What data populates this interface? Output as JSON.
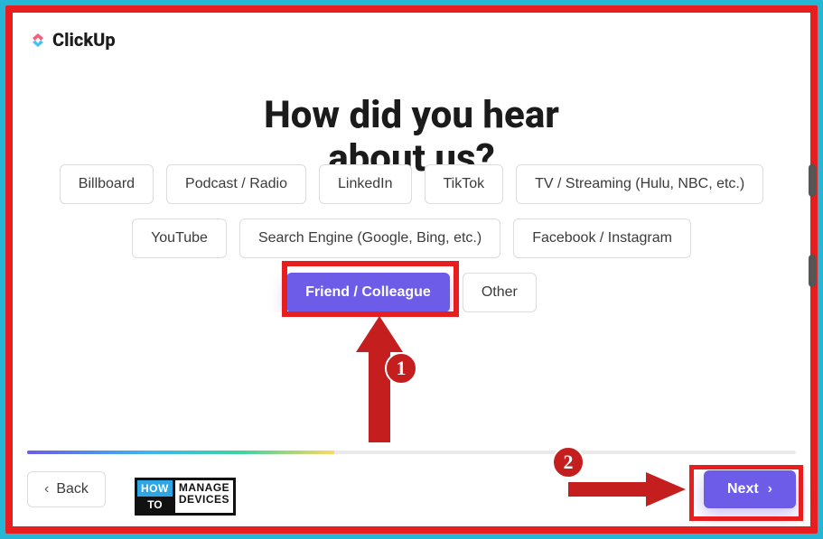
{
  "brand": {
    "name": "ClickUp"
  },
  "heading": {
    "line1": "How did you hear",
    "line2": "about us?"
  },
  "options": {
    "row1": [
      {
        "label": "Billboard",
        "selected": false
      },
      {
        "label": "Podcast / Radio",
        "selected": false
      },
      {
        "label": "LinkedIn",
        "selected": false
      },
      {
        "label": "TikTok",
        "selected": false
      },
      {
        "label": "TV / Streaming (Hulu, NBC, etc.)",
        "selected": false
      }
    ],
    "row2": [
      {
        "label": "YouTube",
        "selected": false
      },
      {
        "label": "Search Engine (Google, Bing, etc.)",
        "selected": false
      },
      {
        "label": "Facebook / Instagram",
        "selected": false
      }
    ],
    "row3": [
      {
        "label": "Friend / Colleague",
        "selected": true
      },
      {
        "label": "Other",
        "selected": false
      }
    ]
  },
  "annotations": {
    "step1": "1",
    "step2": "2"
  },
  "footer": {
    "back_label": "Back",
    "next_label": "Next"
  },
  "watermark": {
    "how": "HOW",
    "to": "TO",
    "line1": "MANAGE",
    "line2": "DEVICES"
  }
}
